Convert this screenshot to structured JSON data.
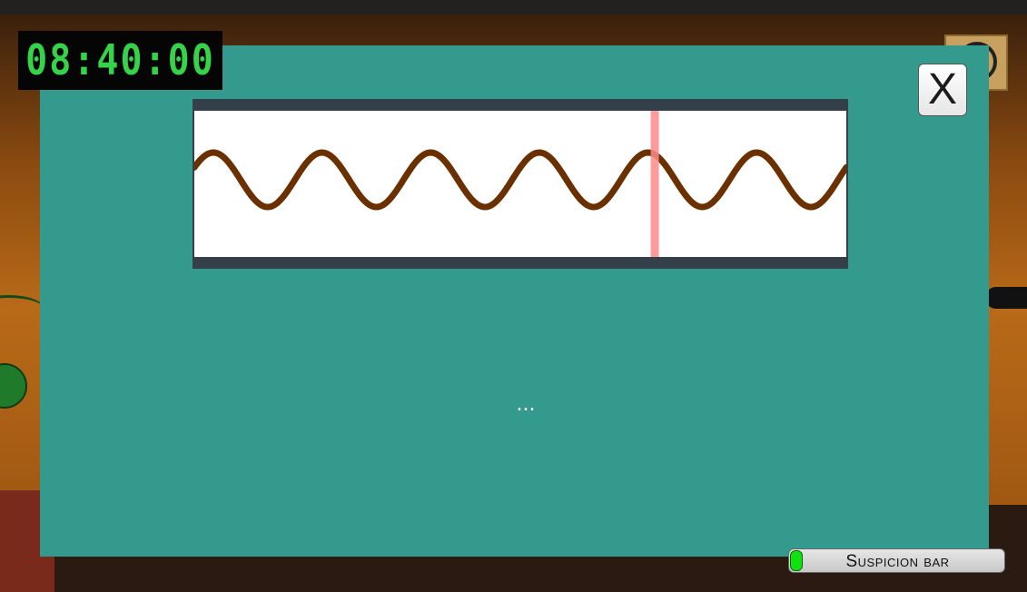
{
  "hud": {
    "timer": "08:40:00",
    "suspicion_bar": {
      "label": "Suspicion bar",
      "level": 0.05
    }
  },
  "panel": {
    "close_label": "X",
    "status_text": "...",
    "wave": {
      "cycles": 6,
      "color": "#6b3000",
      "marker_color": "#ff8a8a",
      "marker_position": 0.7
    }
  },
  "colors": {
    "panel": "#349a8e",
    "timer_digits": "#35d24a",
    "suspicion_fill": "#11e011"
  }
}
